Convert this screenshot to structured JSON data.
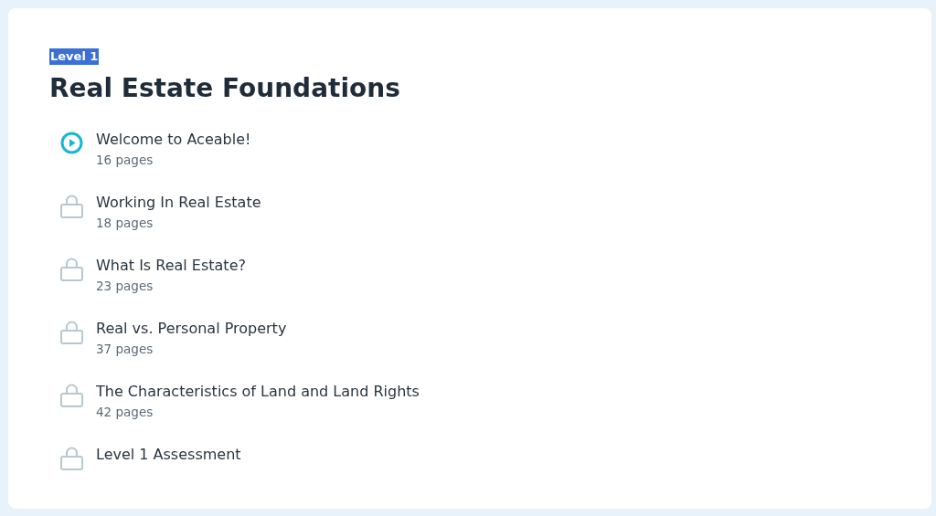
{
  "level_label": "Level 1",
  "title": "Real Estate Foundations",
  "lessons": [
    {
      "title": "Welcome to Aceable!",
      "pages": "16 pages",
      "locked": false
    },
    {
      "title": "Working In Real Estate",
      "pages": "18 pages",
      "locked": true
    },
    {
      "title": "What Is Real Estate?",
      "pages": "23 pages",
      "locked": true
    },
    {
      "title": "Real vs. Personal Property",
      "pages": "37 pages",
      "locked": true
    },
    {
      "title": "The Characteristics of Land and Land Rights",
      "pages": "42 pages",
      "locked": true
    },
    {
      "title": "Level 1 Assessment",
      "locked": true
    }
  ]
}
